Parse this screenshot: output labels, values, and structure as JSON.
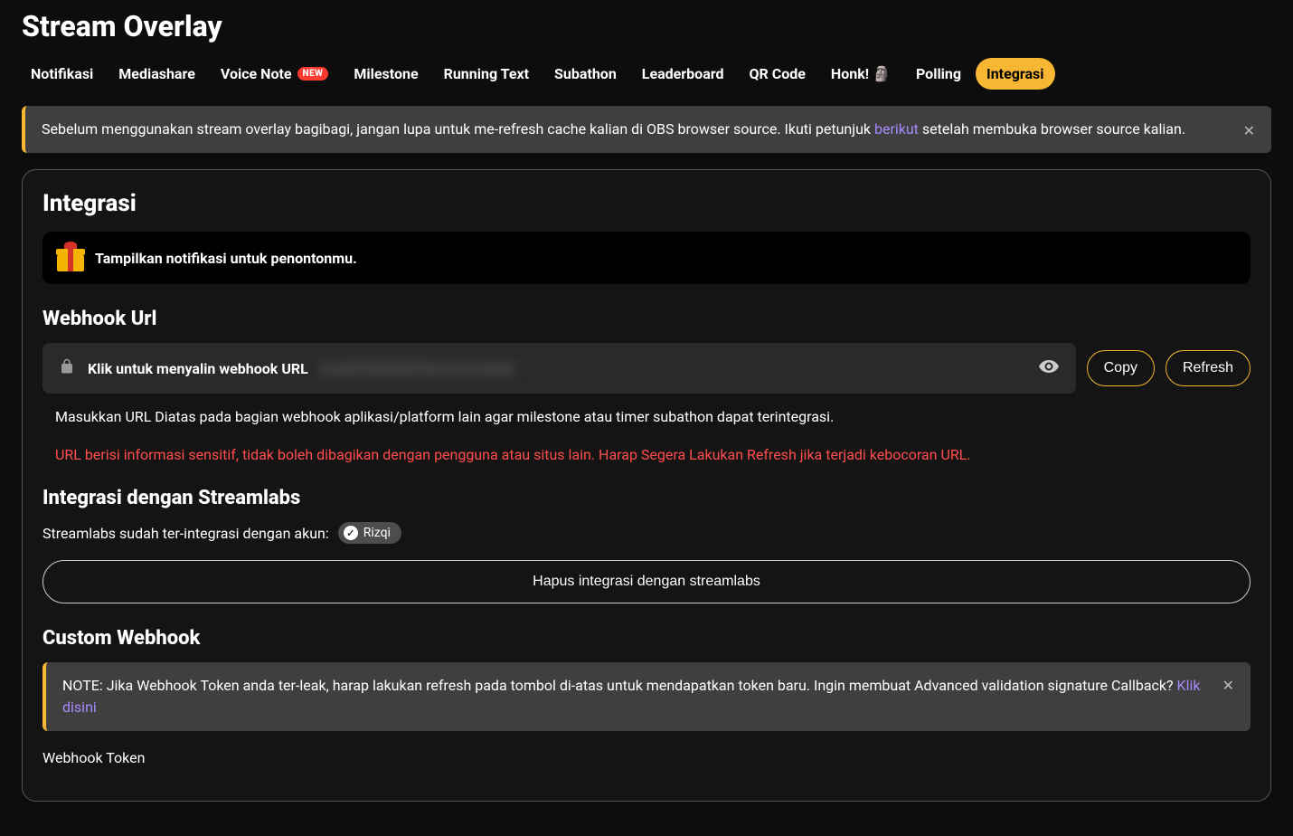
{
  "page_title": "Stream Overlay",
  "tabs": [
    {
      "label": "Notifikasi",
      "active": false
    },
    {
      "label": "Mediashare",
      "active": false
    },
    {
      "label": "Voice Note",
      "active": false,
      "badge": "NEW"
    },
    {
      "label": "Milestone",
      "active": false
    },
    {
      "label": "Running Text",
      "active": false
    },
    {
      "label": "Subathon",
      "active": false
    },
    {
      "label": "Leaderboard",
      "active": false
    },
    {
      "label": "QR Code",
      "active": false
    },
    {
      "label": "Honk! 🗿",
      "active": false
    },
    {
      "label": "Polling",
      "active": false
    },
    {
      "label": "Integrasi",
      "active": true
    }
  ],
  "banner": {
    "text_before": "Sebelum menggunakan stream overlay bagibagi, jangan lupa untuk me-refresh cache kalian di OBS browser source. Ikuti petunjuk ",
    "link": "berikut",
    "text_after": " setelah membuka browser source kalian."
  },
  "card": {
    "title": "Integrasi",
    "notif_text": "Tampilkan notifikasi untuk penontonmu.",
    "webhook_section": "Webhook Url",
    "webhook_placeholder": "Klik untuk menyalin webhook URL",
    "webhook_masked": "XxxXYXXXXXYXxYxYxYxXxX",
    "copy_btn": "Copy",
    "refresh_btn": "Refresh",
    "help_text": "Masukkan URL Diatas pada bagian webhook aplikasi/platform lain agar milestone atau timer subathon dapat terintegrasi.",
    "warn_text": "URL berisi informasi sensitif, tidak boleh dibagikan dengan pengguna atau situs lain. Harap Segera Lakukan Refresh jika terjadi kebocoran URL.",
    "streamlabs_section": "Integrasi dengan Streamlabs",
    "streamlabs_status": "Streamlabs sudah ter-integrasi dengan akun:",
    "streamlabs_account": "Rizqi",
    "remove_btn": "Hapus integrasi dengan streamlabs",
    "custom_section": "Custom Webhook",
    "note_text": "NOTE: Jika Webhook Token anda ter-leak, harap lakukan refresh pada tombol di-atas untuk mendapatkan token baru. Ingin membuat Advanced validation signature Callback? ",
    "note_link": "Klik disini",
    "token_label": "Webhook Token"
  }
}
